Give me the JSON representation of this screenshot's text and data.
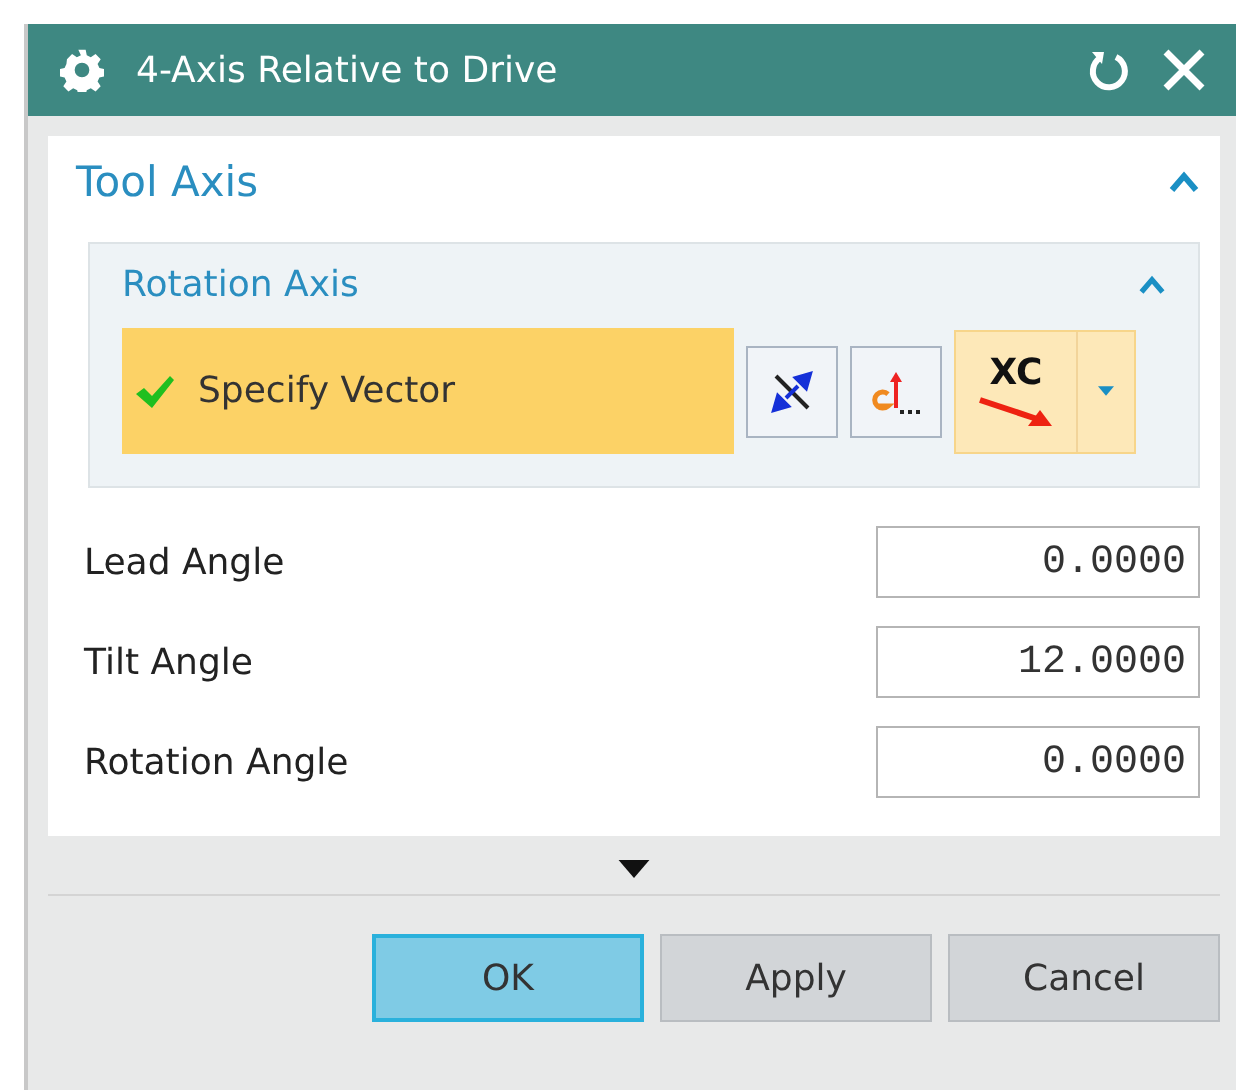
{
  "window": {
    "title": "4-Axis Relative to Drive"
  },
  "tool_axis": {
    "title": "Tool Axis",
    "expanded": true,
    "rotation_axis": {
      "title": "Rotation Axis",
      "expanded": true,
      "specify_vector": {
        "label": "Specify Vector",
        "done": true
      },
      "vector_type": "XC"
    },
    "fields": [
      {
        "label": "Lead Angle",
        "value": "0.0000"
      },
      {
        "label": "Tilt Angle",
        "value": "12.0000"
      },
      {
        "label": "Rotation Angle",
        "value": "0.0000"
      }
    ]
  },
  "buttons": [
    {
      "label": "OK",
      "selected": true
    },
    {
      "label": "Apply",
      "selected": false
    },
    {
      "label": "Cancel",
      "selected": false
    }
  ]
}
